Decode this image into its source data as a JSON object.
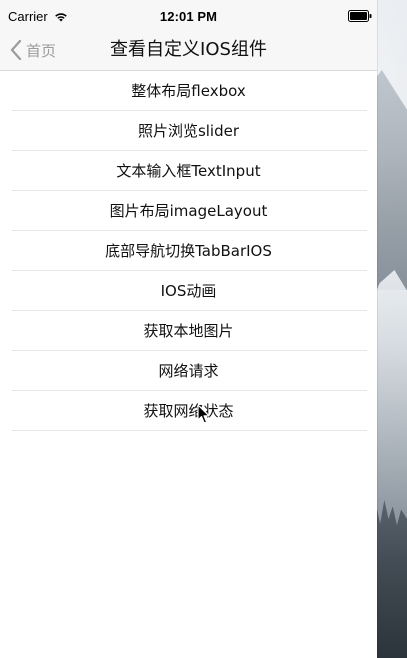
{
  "status_bar": {
    "carrier": "Carrier",
    "time": "12:01 PM",
    "wifi_icon": "wifi-icon",
    "battery_icon": "battery-icon"
  },
  "nav": {
    "back_label": "首页",
    "title": "查看自定义IOS组件"
  },
  "list": {
    "items": [
      {
        "label": "整体布局flexbox"
      },
      {
        "label": "照片浏览slider"
      },
      {
        "label": "文本输入框TextInput"
      },
      {
        "label": "图片布局imageLayout"
      },
      {
        "label": "底部导航切换TabBarIOS"
      },
      {
        "label": "IOS动画"
      },
      {
        "label": "获取本地图片"
      },
      {
        "label": "网络请求"
      },
      {
        "label": "获取网络状态"
      }
    ]
  },
  "colors": {
    "nav_background": "#f7f7f7",
    "separator": "#e6e6e6",
    "back_tint": "#9b9b9b",
    "text": "#111111"
  }
}
